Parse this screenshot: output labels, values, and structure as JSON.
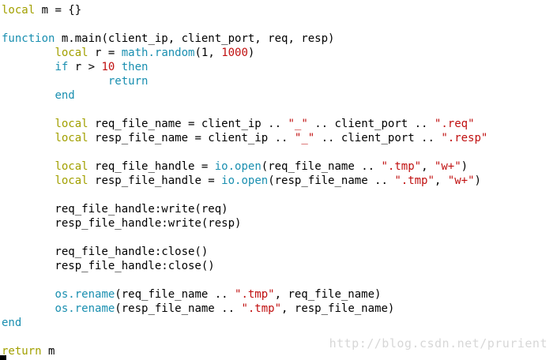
{
  "editor": {
    "watermark": "http://blog.csdn.net/prurient",
    "lines": [
      [
        [
          "kw1",
          "local"
        ],
        [
          "ident",
          " m = {}"
        ]
      ],
      [],
      [
        [
          "kw2",
          "function"
        ],
        [
          "ident",
          " m.main(client_ip, client_port, req, resp)"
        ]
      ],
      [
        [
          "ident",
          "        "
        ],
        [
          "kw1",
          "local"
        ],
        [
          "ident",
          " r = "
        ],
        [
          "kw2",
          "math.random"
        ],
        [
          "ident",
          "(1, "
        ],
        [
          "num",
          "1000"
        ],
        [
          "ident",
          ")"
        ]
      ],
      [
        [
          "ident",
          "        "
        ],
        [
          "kw2",
          "if"
        ],
        [
          "ident",
          " r > "
        ],
        [
          "num",
          "10"
        ],
        [
          "ident",
          " "
        ],
        [
          "kw2",
          "then"
        ]
      ],
      [
        [
          "ident",
          "                "
        ],
        [
          "kw2",
          "return"
        ]
      ],
      [
        [
          "ident",
          "        "
        ],
        [
          "kw2",
          "end"
        ]
      ],
      [],
      [
        [
          "ident",
          "        "
        ],
        [
          "kw1",
          "local"
        ],
        [
          "ident",
          " req_file_name = client_ip .. "
        ],
        [
          "str",
          "\"_\""
        ],
        [
          "ident",
          " .. client_port .. "
        ],
        [
          "str",
          "\".req\""
        ]
      ],
      [
        [
          "ident",
          "        "
        ],
        [
          "kw1",
          "local"
        ],
        [
          "ident",
          " resp_file_name = client_ip .. "
        ],
        [
          "str",
          "\"_\""
        ],
        [
          "ident",
          " .. client_port .. "
        ],
        [
          "str",
          "\".resp\""
        ]
      ],
      [],
      [
        [
          "ident",
          "        "
        ],
        [
          "kw1",
          "local"
        ],
        [
          "ident",
          " req_file_handle = "
        ],
        [
          "kw2",
          "io.open"
        ],
        [
          "ident",
          "(req_file_name .. "
        ],
        [
          "str",
          "\".tmp\""
        ],
        [
          "ident",
          ", "
        ],
        [
          "str",
          "\"w+\""
        ],
        [
          "ident",
          ")"
        ]
      ],
      [
        [
          "ident",
          "        "
        ],
        [
          "kw1",
          "local"
        ],
        [
          "ident",
          " resp_file_handle = "
        ],
        [
          "kw2",
          "io.open"
        ],
        [
          "ident",
          "(resp_file_name .. "
        ],
        [
          "str",
          "\".tmp\""
        ],
        [
          "ident",
          ", "
        ],
        [
          "str",
          "\"w+\""
        ],
        [
          "ident",
          ")"
        ]
      ],
      [],
      [
        [
          "ident",
          "        req_file_handle:write(req)"
        ]
      ],
      [
        [
          "ident",
          "        resp_file_handle:write(resp)"
        ]
      ],
      [],
      [
        [
          "ident",
          "        req_file_handle:close()"
        ]
      ],
      [
        [
          "ident",
          "        resp_file_handle:close()"
        ]
      ],
      [],
      [
        [
          "ident",
          "        "
        ],
        [
          "kw2",
          "os.rename"
        ],
        [
          "ident",
          "(req_file_name .. "
        ],
        [
          "str",
          "\".tmp\""
        ],
        [
          "ident",
          ", req_file_name)"
        ]
      ],
      [
        [
          "ident",
          "        "
        ],
        [
          "kw2",
          "os.rename"
        ],
        [
          "ident",
          "(resp_file_name .. "
        ],
        [
          "str",
          "\".tmp\""
        ],
        [
          "ident",
          ", resp_file_name)"
        ]
      ],
      [
        [
          "kw2",
          "end"
        ]
      ],
      [],
      [
        [
          "kw1",
          "return"
        ],
        [
          "ident",
          " m"
        ]
      ]
    ]
  }
}
